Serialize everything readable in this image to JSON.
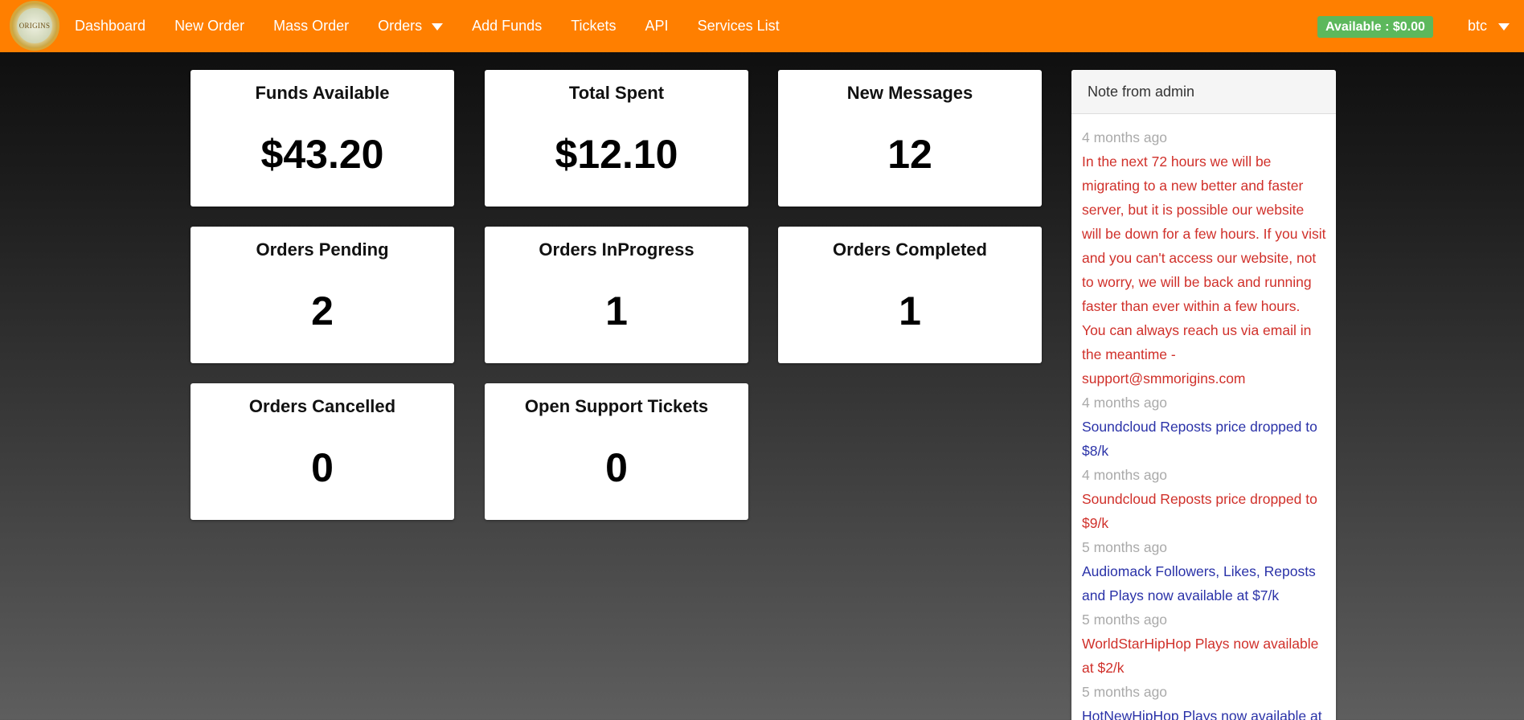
{
  "navbar": {
    "logo_text": "ORIGINS",
    "links": [
      {
        "label": "Dashboard"
      },
      {
        "label": "New Order"
      },
      {
        "label": "Mass Order"
      },
      {
        "label": "Orders"
      },
      {
        "label": "Add Funds"
      },
      {
        "label": "Tickets"
      },
      {
        "label": "API"
      },
      {
        "label": "Services List"
      }
    ],
    "balance": "Available : $0.00",
    "currency": "btc"
  },
  "stats": [
    {
      "title": "Funds Available",
      "value": "$43.20"
    },
    {
      "title": "Total Spent",
      "value": "$12.10"
    },
    {
      "title": "New Messages",
      "value": "12"
    },
    {
      "title": "Orders Pending",
      "value": "2"
    },
    {
      "title": "Orders InProgress",
      "value": "1"
    },
    {
      "title": "Orders Completed",
      "value": "1"
    },
    {
      "title": "Orders Cancelled",
      "value": "0"
    },
    {
      "title": "Open Support Tickets",
      "value": "0"
    }
  ],
  "note": {
    "header": "Note from admin",
    "entries": [
      {
        "time": "4 months ago",
        "text": "In the next 72 hours we will be migrating to a new better and faster server, but it is possible our website will be down for a few hours. If you visit and you can't access our website, not to worry, we will be back and running faster than ever within a few hours. You can always reach us via email in the meantime - support@smmorigins.com"
      },
      {
        "time": "4 months ago",
        "text": "Soundcloud Reposts price dropped to $8/k"
      },
      {
        "time": "4 months ago",
        "text": "Soundcloud Reposts price dropped to $9/k"
      },
      {
        "time": "5 months ago",
        "text": "Audiomack Followers, Likes, Reposts and Plays now available at $7/k"
      },
      {
        "time": "5 months ago",
        "text": "WorldStarHipHop Plays now available at $2/k"
      },
      {
        "time": "5 months ago",
        "text": "HotNewHipHop Plays now available at"
      }
    ]
  },
  "colors": {
    "navbar": "#ff7f00",
    "badge": "#5cb85c",
    "note_red": "#d0302a",
    "note_blue": "#2a32a8",
    "note_time": "#aaaaaa"
  }
}
